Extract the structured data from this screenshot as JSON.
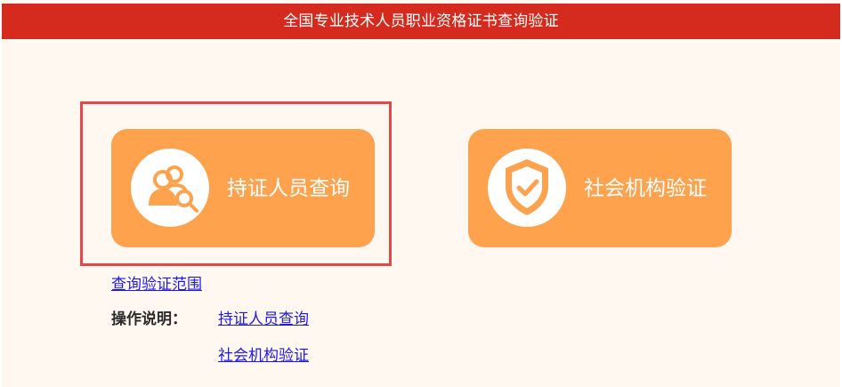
{
  "header": {
    "title": "全国专业技术人员职业资格证书查询验证"
  },
  "cards": [
    {
      "label": "持证人员查询",
      "icon": "user-search-icon"
    },
    {
      "label": "社会机构验证",
      "icon": "shield-check-icon"
    }
  ],
  "links": {
    "scope": "查询验证范围",
    "operation_label": "操作说明：",
    "operation_links": [
      "持证人员查询",
      "社会机构验证"
    ]
  },
  "colors": {
    "header_bg": "#d42b1e",
    "card_bg": "#ffa24d",
    "page_bg": "#fff8f1",
    "highlight": "#e24a4a",
    "link": "#1d1ae8"
  }
}
